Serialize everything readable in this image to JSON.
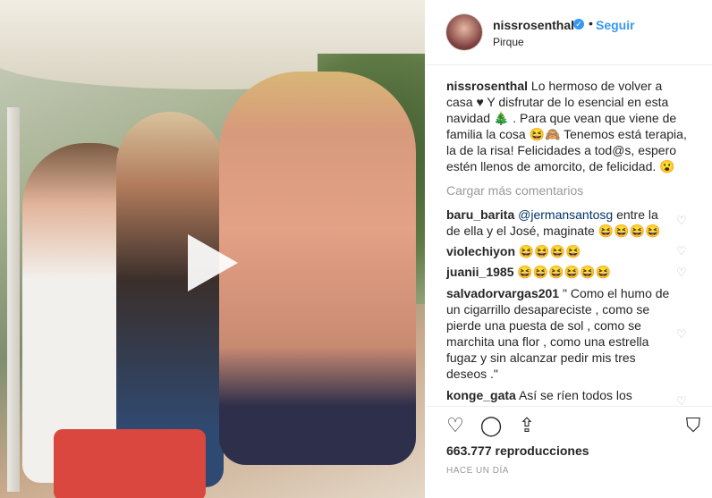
{
  "post": {
    "username": "nissrosenthal",
    "follow_label": "Seguir",
    "separator": "•",
    "location": "Pirque",
    "caption_text": "Lo hermoso de volver a casa ♥︎ Y disfrutar de lo esencial en esta navidad 🎄 . Para que vean que viene de familia la cosa 😆🙈 Tenemos está terapia, la de la risa! Felicidades a tod@s, espero estén llenos de amorcito, de felicidad. 😮",
    "load_more": "Cargar más comentarios",
    "views": "663.777 reproducciones",
    "timestamp": "HACE UN DÍA"
  },
  "comments": [
    {
      "user": "baru_barita",
      "mention": "@jermansantosg",
      "text": " entre la de ella y el José, maginate 😆😆😆😆"
    },
    {
      "user": "violechiyon",
      "mention": "",
      "text": "😆😆😆😆"
    },
    {
      "user": "juanii_1985",
      "mention": "",
      "text": "😆😆😆😆😆😆"
    },
    {
      "user": "salvadorvargas201",
      "mention": "",
      "text": "\" Como el humo de un cigarrillo desapareciste , como se pierde una puesta de sol , como se marchita una flor , como una estrella fugaz y sin alcanzar pedir mis tres deseos .\""
    },
    {
      "user": "konge_gata",
      "mention": "",
      "text": "Así se ríen todos los"
    }
  ],
  "icons": {
    "verified": "verified-badge-icon",
    "heart": "heart-icon",
    "comment": "comment-icon",
    "share": "share-icon",
    "bookmark": "bookmark-icon",
    "play": "play-icon"
  }
}
